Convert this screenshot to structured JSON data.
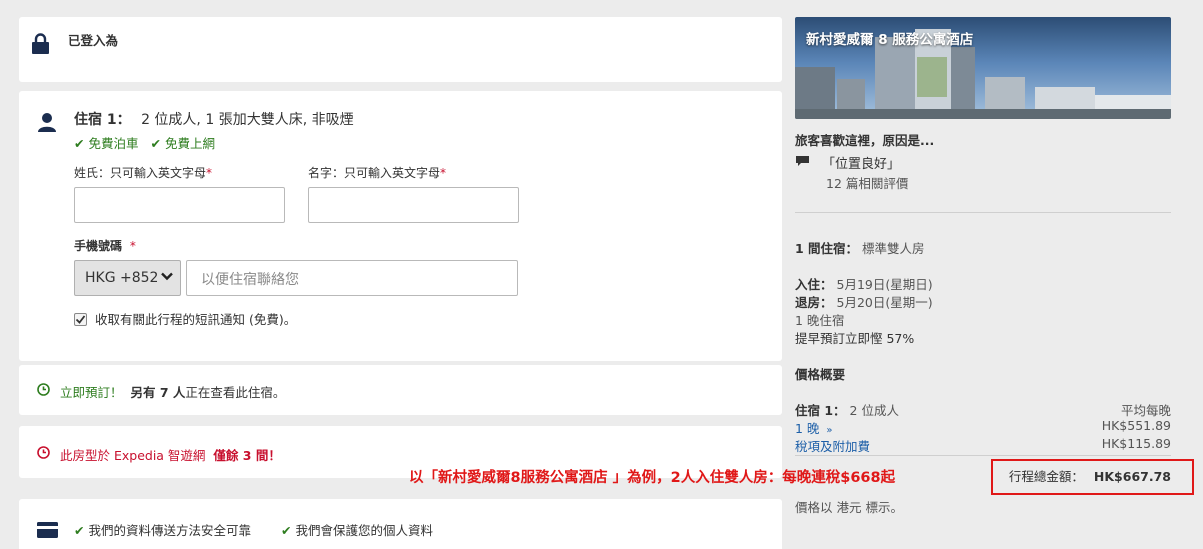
{
  "login": {
    "text": "已登入為"
  },
  "room": {
    "title": "住宿 1：",
    "details": "2 位成人, 1 張加大雙人床, 非吸煙",
    "amenities": [
      "免費泊車",
      "免費上網"
    ],
    "surname_label": "姓氏：只可輸入英文字母",
    "given_label": "名字：只可輸入英文字母",
    "required_mark": "*",
    "phone_label": "手機號碼",
    "phone_code": "HKG +852",
    "phone_placeholder": "以便住宿聯絡您",
    "sms_label": "收取有關此行程的短訊通知 (免費)。"
  },
  "viewing": {
    "prefix": "立即預訂！",
    "count_text": "另有 7 人",
    "suffix": "正在查看此住宿。"
  },
  "scarcity": {
    "prefix": "此房型於 Expedia 智遊網",
    "remaining": "僅餘 3 間！"
  },
  "security": {
    "items": [
      "我們的資料傳送方法安全可靠",
      "我們會保護您的個人資料"
    ]
  },
  "hotel": {
    "name": "新村愛威爾 8 服務公寓酒店",
    "why_title": "旅客喜歡這裡，原因是...",
    "highlight": "「位置良好」",
    "reviews": "12 篇相關評價"
  },
  "stay": {
    "room_label": "1 間住宿：",
    "room_type": "標準雙人房",
    "checkin_label": "入住：",
    "checkin": "5月19日(星期日)",
    "checkout_label": "退房：",
    "checkout": "5月20日(星期一)",
    "nights": "1 晚住宿",
    "discount": "提早預訂立即慳 57%"
  },
  "price": {
    "summary_title": "價格概要",
    "room_label": "住宿 1：",
    "room_guests": "2 位成人",
    "avg_label": "平均每晚",
    "nights_link": "1 晚",
    "nights_price": "HK$551.89",
    "tax_link": "稅項及附加費",
    "tax_price": "HK$115.89",
    "total_label": "行程總金額：",
    "total_value": "HK$667.78",
    "currency_note": "價格以 港元 標示。"
  },
  "annotation": "以「新村愛威爾8服務公寓酒店 」為例，2人入住雙人房：每晚連稅$668起",
  "colors": {
    "green": "#2e7d1f",
    "red": "#c8102e",
    "link": "#1d5fa8",
    "icon_navy": "#1b2d4f"
  }
}
